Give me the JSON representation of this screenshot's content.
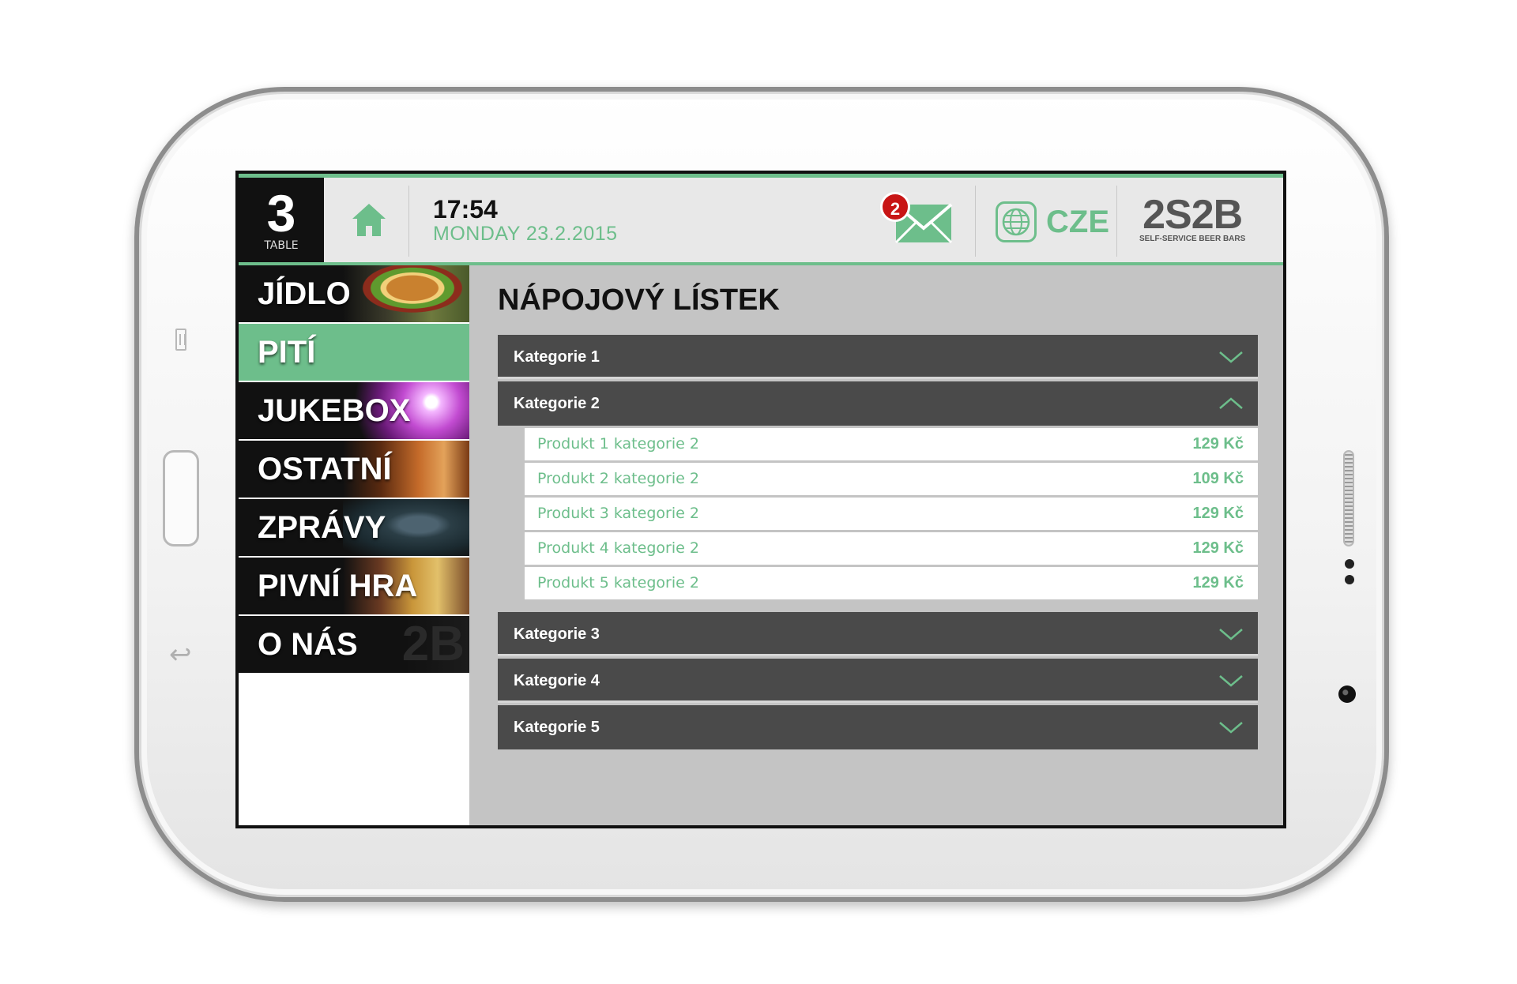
{
  "header": {
    "table_number": "3",
    "table_label": "TABLE",
    "time": "17:54",
    "date": "MONDAY 23.2.2015",
    "message_count": "2",
    "language": "CZE",
    "logo_text": "2S2B",
    "logo_subtitle": "SELF-SERVICE BEER BARS"
  },
  "sidebar": {
    "items": [
      {
        "label": "JÍDLO"
      },
      {
        "label": "PITÍ"
      },
      {
        "label": "JUKEBOX"
      },
      {
        "label": "OSTATNÍ"
      },
      {
        "label": "ZPRÁVY"
      },
      {
        "label": "PIVNÍ HRA"
      },
      {
        "label": "O NÁS"
      }
    ]
  },
  "main": {
    "title": "NÁPOJOVÝ LÍSTEK",
    "categories": [
      {
        "label": "Kategorie 1"
      },
      {
        "label": "Kategorie 2"
      },
      {
        "label": "Kategorie 3"
      },
      {
        "label": "Kategorie 4"
      },
      {
        "label": "Kategorie 5"
      }
    ],
    "products": [
      {
        "name": "Produkt 1 kategorie 2",
        "price": "129 Kč"
      },
      {
        "name": "Produkt 2 kategorie 2",
        "price": "109 Kč"
      },
      {
        "name": "Produkt 3 kategorie 2",
        "price": "129 Kč"
      },
      {
        "name": "Produkt 4 kategorie 2",
        "price": "129 Kč"
      },
      {
        "name": "Produkt 5 kategorie 2",
        "price": "129 Kč"
      }
    ]
  },
  "colors": {
    "accent_green": "#6dbe8b",
    "category_bg": "#4a4a4a",
    "badge_red": "#c81515"
  },
  "icons": [
    "home-icon",
    "mail-icon",
    "globe-icon",
    "chevron-down-icon",
    "chevron-up-icon"
  ]
}
